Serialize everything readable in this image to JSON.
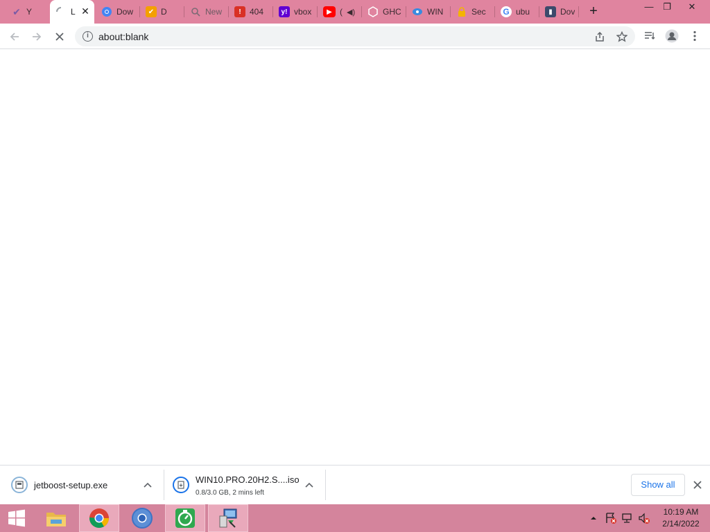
{
  "browser": {
    "tabs": [
      {
        "title": "Y",
        "icon": "check-icon",
        "color": "#7b5ba6"
      },
      {
        "title": "L",
        "icon": "loading-spinner-icon",
        "color": "#9aa0a6",
        "active": true
      },
      {
        "title": "Dow",
        "icon": "chrome-icon",
        "color": "#4285f4"
      },
      {
        "title": "D",
        "icon": "check-icon",
        "color": "#d33"
      },
      {
        "title": "New",
        "icon": "search-icon",
        "color": "#7d6b75"
      },
      {
        "title": "404",
        "icon": "error-page-icon",
        "color": "#d93025"
      },
      {
        "title": "vbox",
        "icon": "yahoo-icon",
        "color": "#6001d2"
      },
      {
        "title": "(",
        "icon": "youtube-icon",
        "color": "#ff0000",
        "audio": true
      },
      {
        "title": "GHC",
        "icon": "hexagon-icon",
        "color": "#ffffff"
      },
      {
        "title": "WIN",
        "icon": "eye-icon",
        "color": "#3a8be0"
      },
      {
        "title": "Sec",
        "icon": "lock-icon",
        "color": "#f4b400"
      },
      {
        "title": "ubu",
        "icon": "google-icon",
        "color": "#4285f4"
      },
      {
        "title": "Dov",
        "icon": "book-icon",
        "color": "#3c4a6b"
      }
    ],
    "new_tab_label": "+",
    "window_controls": {
      "minimize": "—",
      "restore": "❐",
      "close": "✕"
    },
    "address": "about:blank"
  },
  "downloads": {
    "items": [
      {
        "name": "jetboost-setup.exe",
        "status": ""
      },
      {
        "name": "WIN10.PRO.20H2.S....iso",
        "status": "0.8/3.0 GB, 2 mins left"
      }
    ],
    "show_all_label": "Show all"
  },
  "taskbar": {
    "apps": [
      {
        "name": "file-explorer-icon"
      },
      {
        "name": "chrome-icon",
        "active": true
      },
      {
        "name": "chromium-icon"
      },
      {
        "name": "timer-icon"
      },
      {
        "name": "installer-icon"
      }
    ],
    "clock": {
      "time": "10:19 AM",
      "date": "2/14/2022"
    }
  }
}
